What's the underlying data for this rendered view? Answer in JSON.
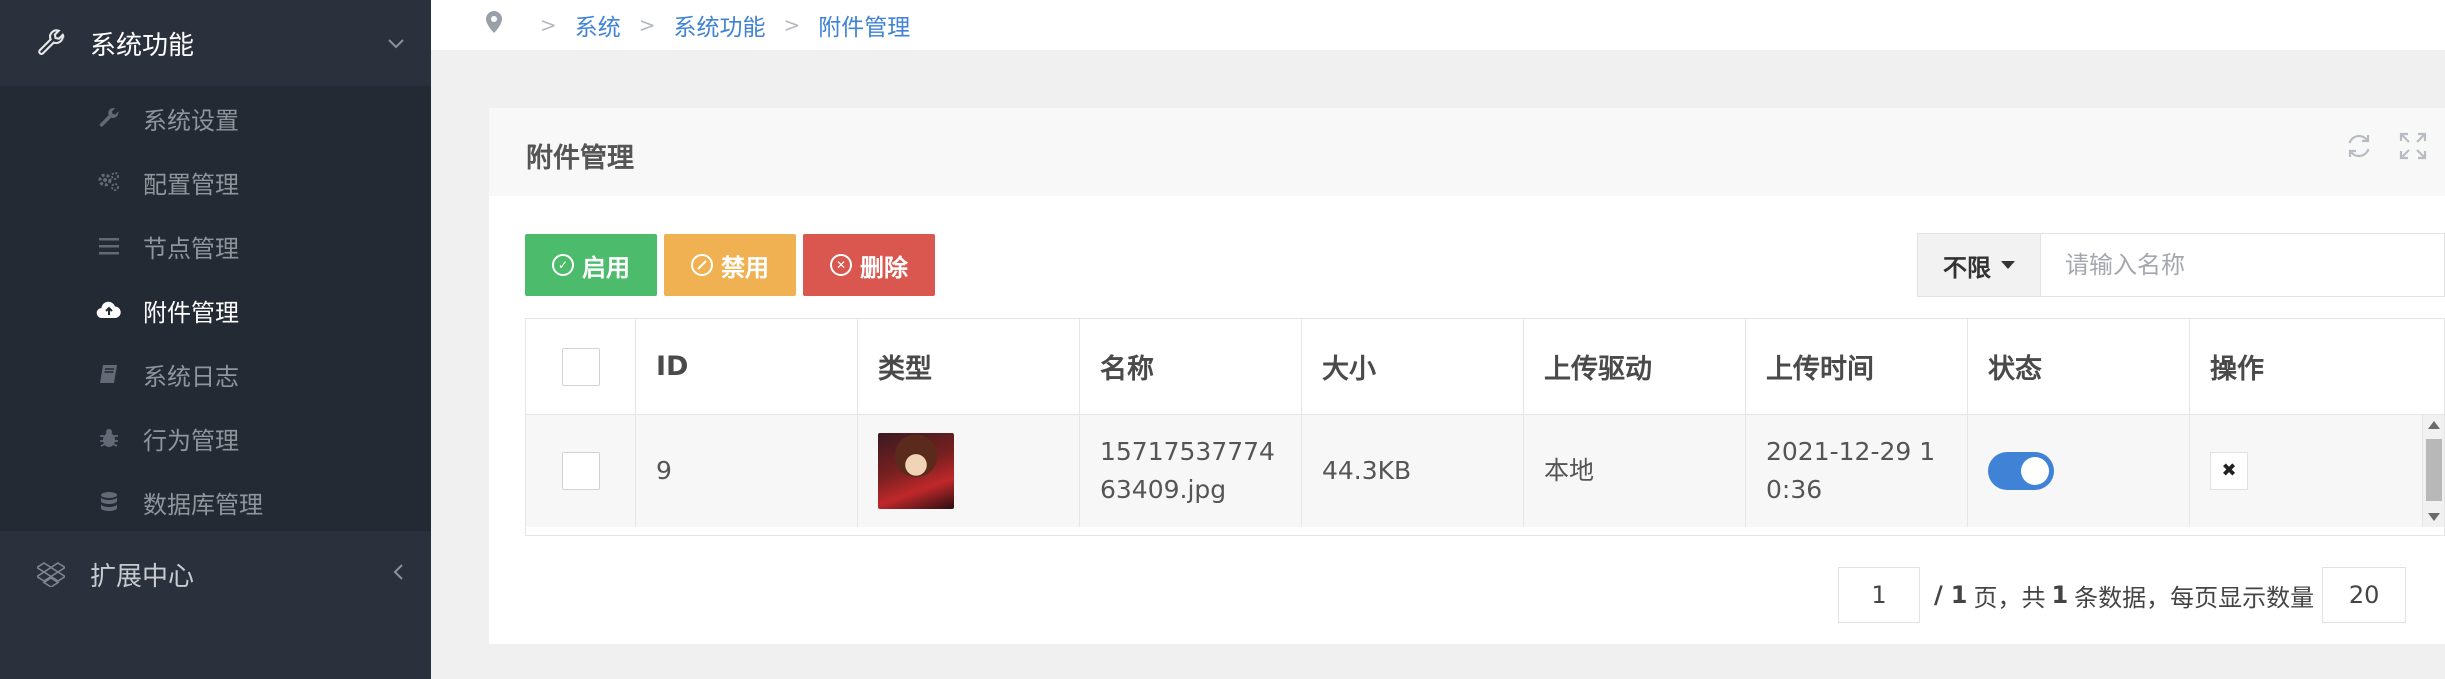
{
  "sidebar": {
    "groups": [
      {
        "label": "系统功能",
        "icon": "wrench-icon",
        "expanded": true
      },
      {
        "label": "扩展中心",
        "icon": "dropbox-icon",
        "expanded": false
      }
    ],
    "items": [
      {
        "label": "系统设置",
        "icon": "wrench-icon"
      },
      {
        "label": "配置管理",
        "icon": "cogs-icon"
      },
      {
        "label": "节点管理",
        "icon": "list-icon"
      },
      {
        "label": "附件管理",
        "icon": "cloud-upload-icon",
        "active": true
      },
      {
        "label": "系统日志",
        "icon": "book-icon"
      },
      {
        "label": "行为管理",
        "icon": "bug-icon"
      },
      {
        "label": "数据库管理",
        "icon": "database-icon"
      }
    ]
  },
  "breadcrumb": [
    "系统",
    "系统功能",
    "附件管理"
  ],
  "panel": {
    "title": "附件管理"
  },
  "toolbar": {
    "enable_label": "启用",
    "disable_label": "禁用",
    "delete_label": "删除",
    "filter_value": "不限",
    "search_placeholder": "请输入名称"
  },
  "table": {
    "columns": [
      "ID",
      "类型",
      "名称",
      "大小",
      "上传驱动",
      "上传时间",
      "状态",
      "操作"
    ],
    "rows": [
      {
        "id": "9",
        "type": "image-thumbnail",
        "name": "1571753777463409.jpg",
        "name_line1": "15717537774",
        "name_line2": "63409.jpg",
        "size": "44.3KB",
        "driver": "本地",
        "time_line1": "2021-12-29 1",
        "time_line2": "0:36",
        "status_on": true
      }
    ]
  },
  "pagination": {
    "current_page": "1",
    "sep": "/",
    "total_pages": "1",
    "text_pages": "页，共",
    "total_records": "1",
    "text_records": "条数据，每页显示数量",
    "page_size": "20"
  },
  "colors": {
    "sidebar_bg": "#2b313c",
    "submenu_bg": "#242a34",
    "link": "#3f82d6",
    "enable": "#4cbb6c",
    "disable": "#f0b152",
    "delete": "#d9574f",
    "toggle_on": "#3f82d6"
  }
}
